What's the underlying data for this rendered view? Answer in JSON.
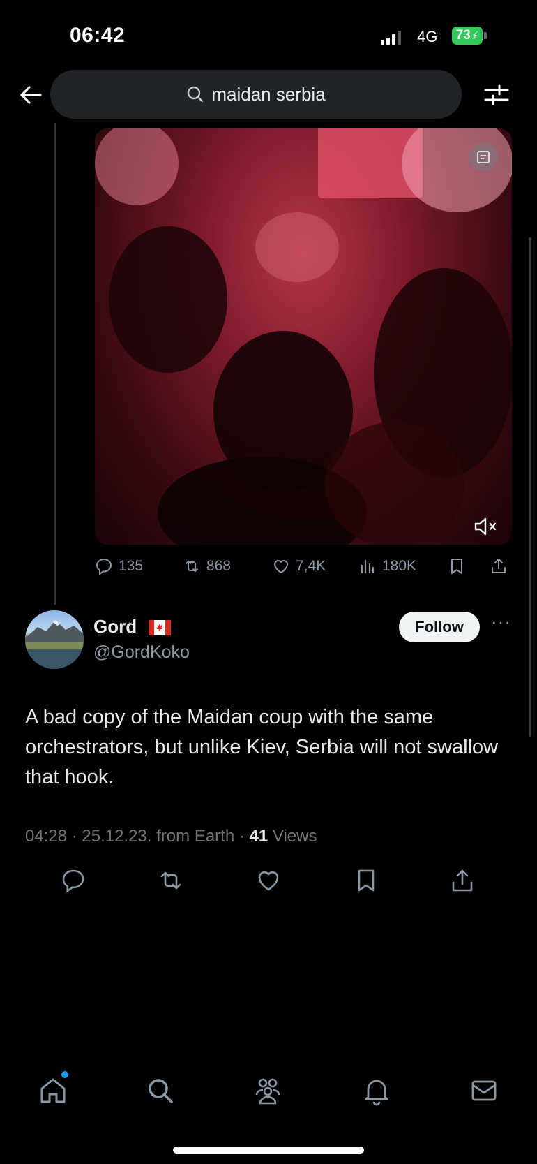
{
  "status_bar": {
    "time": "06:42",
    "network": "4G",
    "battery": "73"
  },
  "header": {
    "search_query": "maidan serbia"
  },
  "prev_tweet": {
    "actions": {
      "replies": "135",
      "retweets": "868",
      "likes": "7,4K",
      "views": "180K"
    }
  },
  "tweet": {
    "author_name": "Gord",
    "handle": "@GordKoko",
    "follow_label": "Follow",
    "more_label": "···",
    "text": "A bad copy of the Maidan coup with the same orchestrators, but unlike Kiev, Serbia will not swallow that hook.",
    "meta_prefix": "04:28 · 25.12.23. from Earth · ",
    "views_count": "41",
    "views_label": " Views"
  },
  "icons": {
    "back": "arrow-left-icon",
    "search": "search-icon",
    "filter": "sliders-icon",
    "reply": "reply-icon",
    "retweet": "retweet-icon",
    "like": "heart-icon",
    "views": "bar-chart-icon",
    "bookmark": "bookmark-icon",
    "share": "share-icon",
    "nav": [
      "home-icon",
      "search-icon",
      "communities-icon",
      "bell-icon",
      "mail-icon"
    ]
  },
  "colors": {
    "background": "#000000",
    "accent": "#1d9bf0",
    "muted": "#71767b",
    "battery": "#34c759"
  }
}
